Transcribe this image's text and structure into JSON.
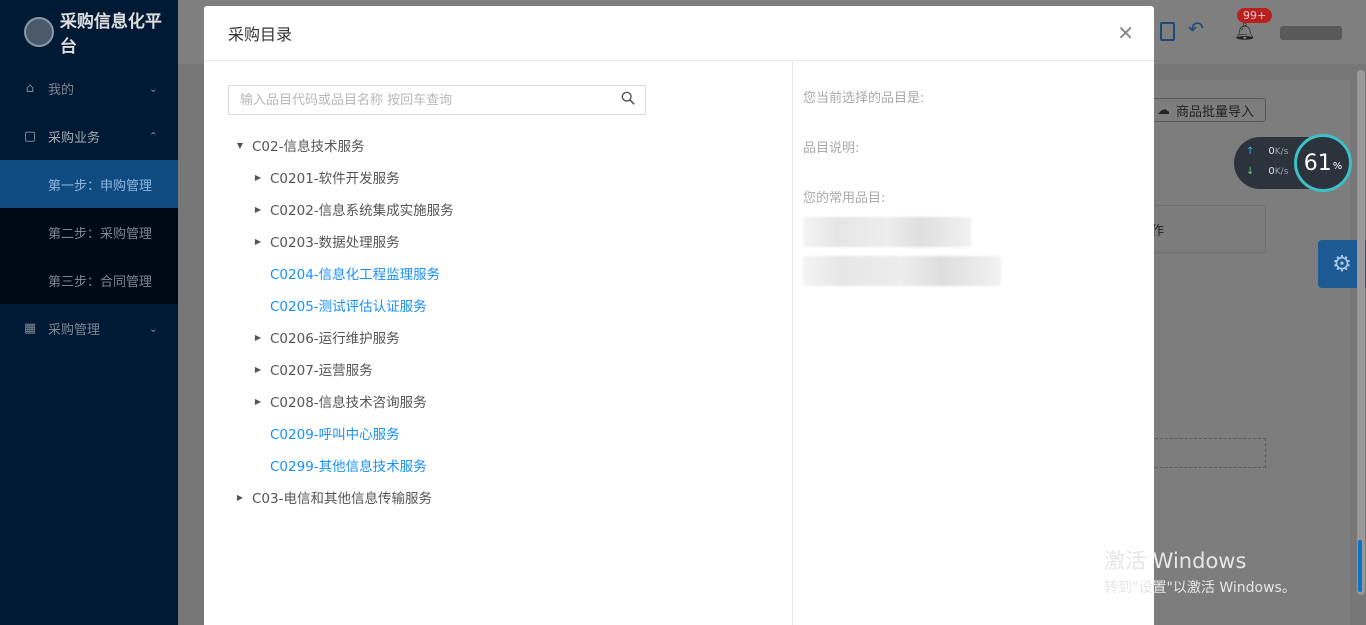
{
  "app": {
    "logo_text": "采购信息化平台"
  },
  "sidebar": {
    "items": [
      {
        "label": "我的",
        "icon": "home-icon",
        "chevron": "⌄"
      },
      {
        "label": "采购业务",
        "icon": "briefcase-icon",
        "chevron": "⌃"
      },
      {
        "label": "第一步：申购管理"
      },
      {
        "label": "第二步：采购管理"
      },
      {
        "label": "第三步：合同管理"
      },
      {
        "label": "采购管理",
        "icon": "table-icon",
        "chevron": "⌄"
      }
    ]
  },
  "topbar": {
    "notification_count": "99+"
  },
  "page": {
    "import_button": "商品批量导入",
    "table_header_fragment": "作"
  },
  "net_widget": {
    "upload": "0",
    "download": "0",
    "unit": "K/s",
    "cpu_percent": "61",
    "percent_sign": "%"
  },
  "modal": {
    "title": "采购目录",
    "search_placeholder": "输入品目代码或品目名称 按回车查询",
    "tree": [
      {
        "label": "C02-信息技术服务",
        "level": 1,
        "toggle": "▼"
      },
      {
        "label": "C0201-软件开发服务",
        "level": 2,
        "toggle": "▶"
      },
      {
        "label": "C0202-信息系统集成实施服务",
        "level": 2,
        "toggle": "▶"
      },
      {
        "label": "C0203-数据处理服务",
        "level": 2,
        "toggle": "▶"
      },
      {
        "label": "C0204-信息化工程监理服务",
        "level": 2,
        "toggle": ""
      },
      {
        "label": "C0205-测试评估认证服务",
        "level": 2,
        "toggle": ""
      },
      {
        "label": "C0206-运行维护服务",
        "level": 2,
        "toggle": "▶"
      },
      {
        "label": "C0207-运营服务",
        "level": 2,
        "toggle": "▶"
      },
      {
        "label": "C0208-信息技术咨询服务",
        "level": 2,
        "toggle": "▶"
      },
      {
        "label": "C0209-呼叫中心服务",
        "level": 2,
        "toggle": ""
      },
      {
        "label": "C0299-其他信息技术服务",
        "level": 2,
        "toggle": ""
      },
      {
        "label": "C03-电信和其他信息传输服务",
        "level": 1,
        "toggle": "▶"
      }
    ],
    "right": {
      "selected_label": "您当前选择的品目是:",
      "desc_label": "品目说明:",
      "common_label": "您的常用品目:"
    }
  },
  "watermark": {
    "title": "激活 Windows",
    "subtitle": "转到\"设置\"以激活 Windows。"
  }
}
